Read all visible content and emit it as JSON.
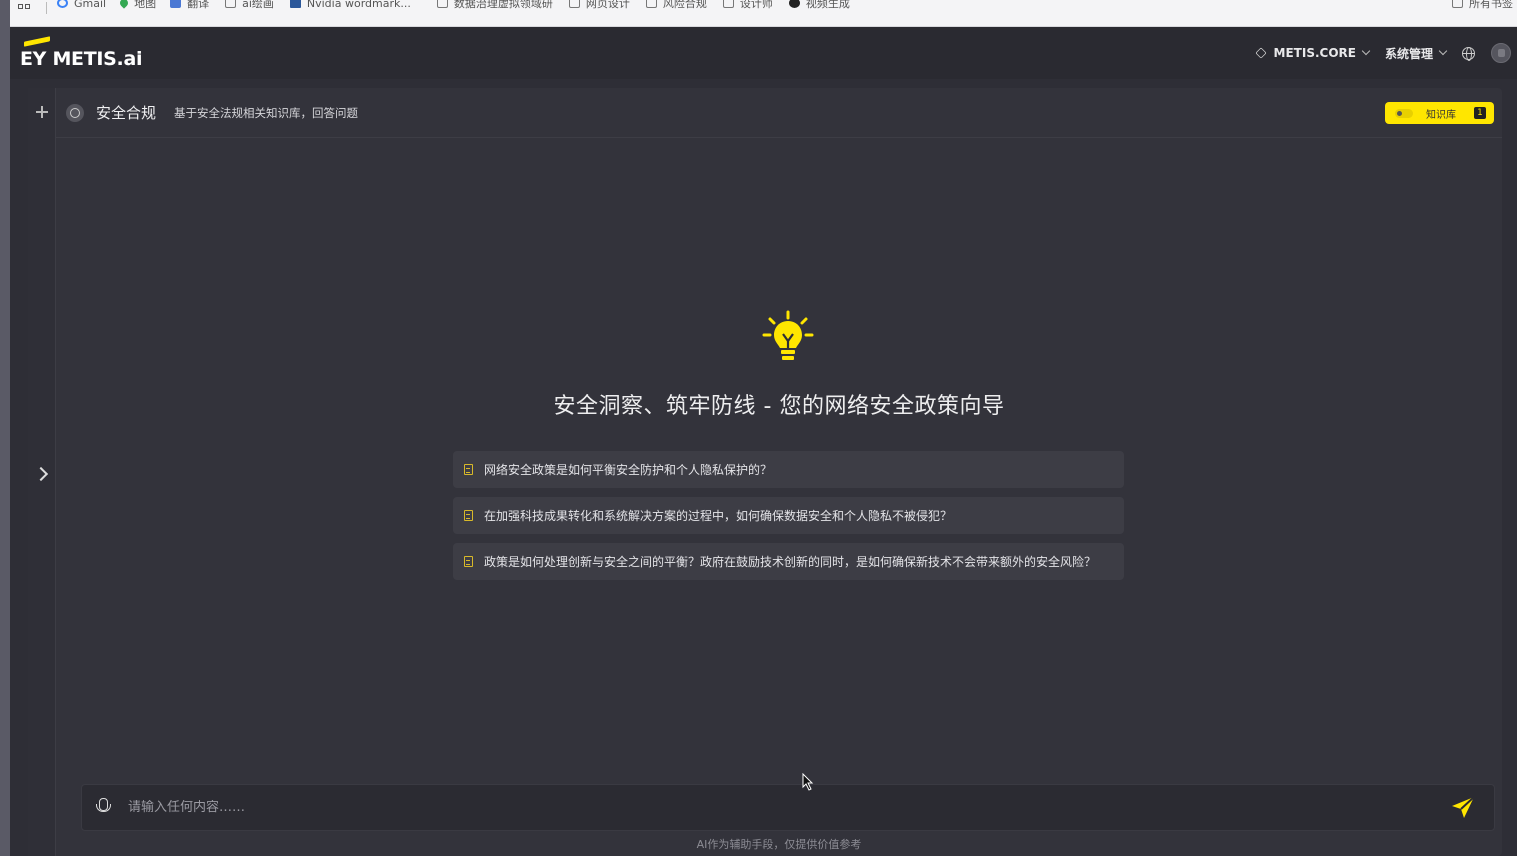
{
  "bookmarks": [
    {
      "label": "Gmail",
      "icon": "google-icon"
    },
    {
      "label": "地图",
      "icon": "maps-icon"
    },
    {
      "label": "翻译",
      "icon": "translate-icon"
    },
    {
      "label": "ai绘画",
      "icon": "folder-icon"
    },
    {
      "label": "Nvidia wordmark...",
      "icon": "word-icon"
    },
    {
      "label": "数据治理虚拟领域研",
      "icon": "folder-icon"
    },
    {
      "label": "网页设计",
      "icon": "folder-icon"
    },
    {
      "label": "风险合规",
      "icon": "folder-icon"
    },
    {
      "label": "设计师",
      "icon": "folder-icon"
    },
    {
      "label": "视频生成",
      "icon": "dot-icon"
    }
  ],
  "bookmarks_right": "所有书签",
  "header": {
    "logo": "EY METIS.ai",
    "workspace_menu": "METIS.CORE",
    "admin_menu": "系统管理"
  },
  "assistant": {
    "name": "安全合规",
    "description": "基于安全法规相关知识库，回答问题",
    "kb_label": "知识库",
    "kb_count": "1"
  },
  "hero": {
    "title": "安全洞察、筑牢防线 - 您的网络安全政策向导"
  },
  "suggestions": [
    "网络安全政策是如何平衡安全防护和个人隐私保护的？",
    "在加强科技成果转化和系统解决方案的过程中，如何确保数据安全和个人隐私不被侵犯？",
    "政策是如何处理创新与安全之间的平衡？政府在鼓励技术创新的同时，是如何确保新技术不会带来额外的安全风险？"
  ],
  "input": {
    "placeholder": "请输入任何内容……",
    "value": ""
  },
  "disclaimer": "AI作为辅助手段，仅提供价值参考",
  "colors": {
    "accent": "#ffe600",
    "background": "#2e2e36",
    "panel": "#33333b",
    "suggestion_bg": "#3d3d45"
  }
}
